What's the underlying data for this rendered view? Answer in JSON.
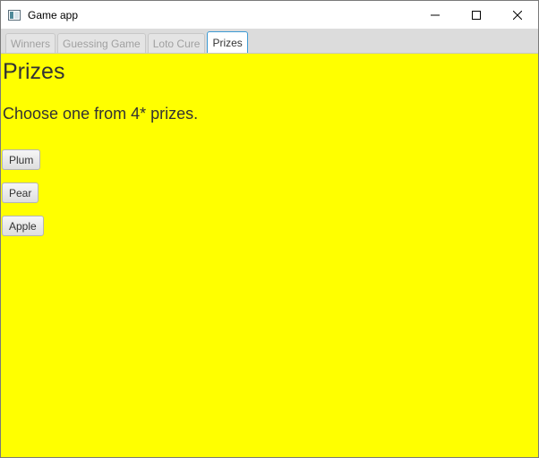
{
  "window": {
    "title": "Game app",
    "app_icon": "window-app-icon",
    "controls": [
      "minimize-icon",
      "maximize-icon",
      "close-icon"
    ]
  },
  "tabs": [
    {
      "label": "Winners",
      "selected": false
    },
    {
      "label": "Guessing Game",
      "selected": false
    },
    {
      "label": "Loto Cure",
      "selected": false
    },
    {
      "label": "Prizes",
      "selected": true
    }
  ],
  "main": {
    "heading": "Prizes",
    "subtext": "Choose one from 4* prizes.",
    "buttons": [
      {
        "label": "Plum"
      },
      {
        "label": "Pear"
      },
      {
        "label": "Apple"
      }
    ]
  },
  "colors": {
    "content_background": "#ffff00",
    "selected_tab_border": "#3d9ad4"
  }
}
